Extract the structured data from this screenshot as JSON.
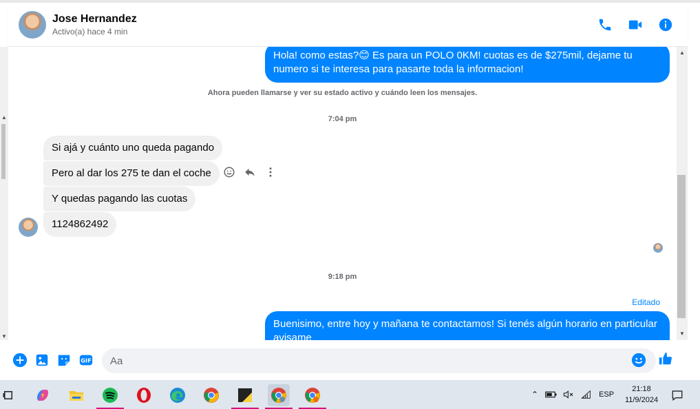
{
  "header": {
    "name": "Jose Hernandez",
    "status": "Activo(a) hace 4 min"
  },
  "messages": {
    "out1": "Hola! como estas?😊 Es para un POLO 0KM! cuotas es de $275mil, dejame tu numero si te interesa para pasarte toda la informacion!",
    "system": "Ahora pueden llamarse y ver su estado activo y cuándo leen los mensajes.",
    "time1": "7:04 pm",
    "in1": "Si ajá y cuánto uno queda pagando",
    "in2": "Pero al dar los 275 te dan el coche",
    "in3": "Y quedas pagando las cuotas",
    "in4": "1124862492",
    "time2": "9:18 pm",
    "edited": "Editado",
    "out2": "Buenisimo, entre hoy y mañana te contactamos! Si tenés algún horario en particular avisame"
  },
  "composer": {
    "placeholder": "Aa"
  },
  "taskbar": {
    "lang": "ESP",
    "time": "21:18",
    "date": "11/9/2024"
  },
  "colors": {
    "accent": "#0084ff",
    "incoming": "#f0f0f0"
  }
}
